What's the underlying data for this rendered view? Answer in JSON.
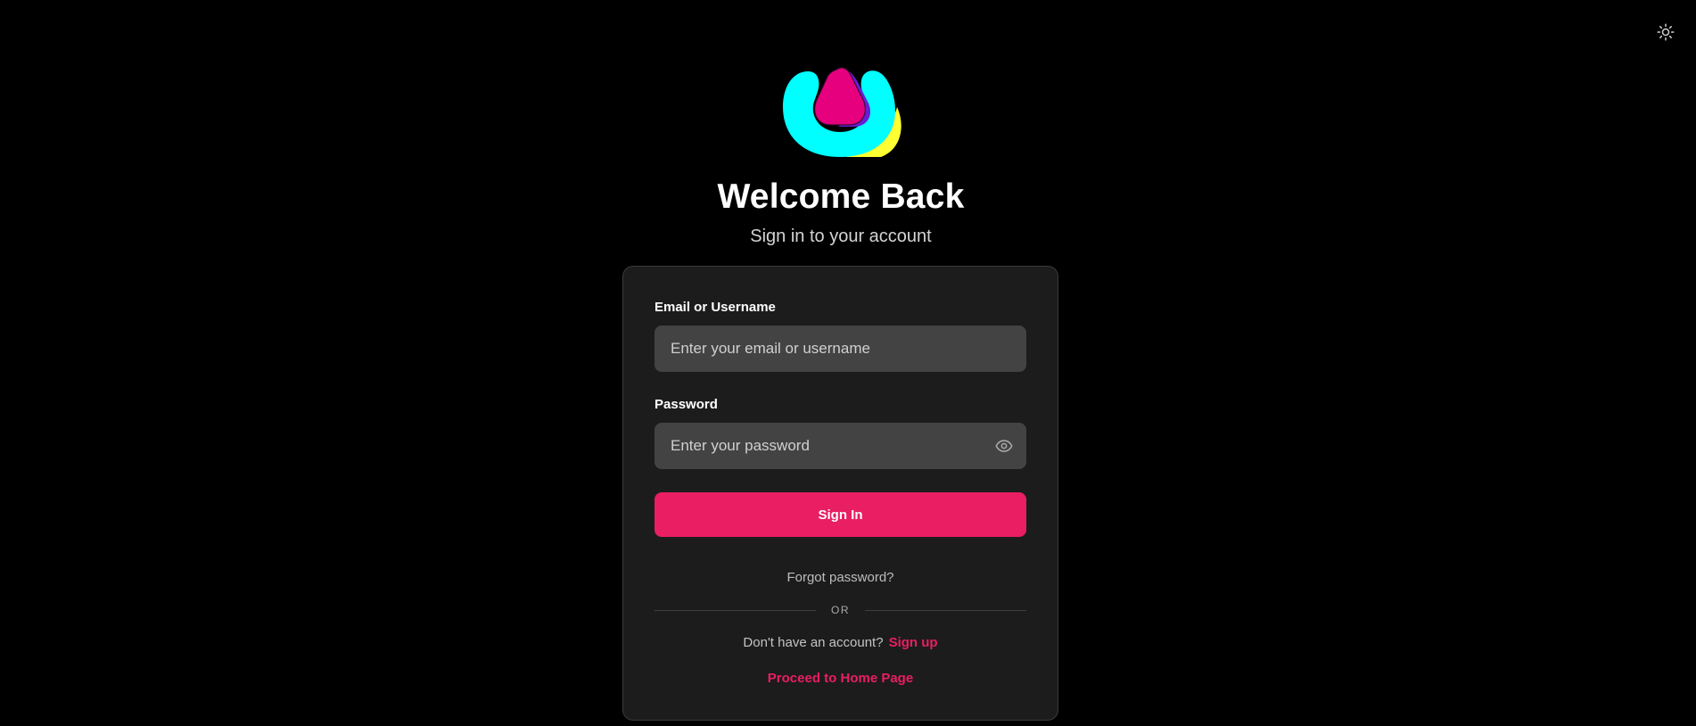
{
  "header": {
    "theme_toggle_icon": "sun-icon"
  },
  "brand": {
    "logo_icon": "brand-logo-icon",
    "colors": {
      "cyan": "#00ffff",
      "pink": "#e6007e",
      "purple": "#6a1bd6",
      "yellow": "#ffff33"
    }
  },
  "hero": {
    "title": "Welcome Back",
    "subtitle": "Sign in to your account"
  },
  "form": {
    "email_label": "Email or Username",
    "email_placeholder": "Enter your email or username",
    "email_value": "",
    "password_label": "Password",
    "password_placeholder": "Enter your password",
    "password_value": "",
    "password_visibility_icon": "eye-icon",
    "submit_label": "Sign In",
    "forgot_label": "Forgot password?",
    "divider_label": "OR",
    "signup_prompt": "Don't have an account?",
    "signup_link": "Sign up",
    "home_link": "Proceed to Home Page"
  },
  "colors": {
    "accent": "#e91e63",
    "background": "#000000",
    "card": "#1c1c1c",
    "input": "#434343"
  }
}
